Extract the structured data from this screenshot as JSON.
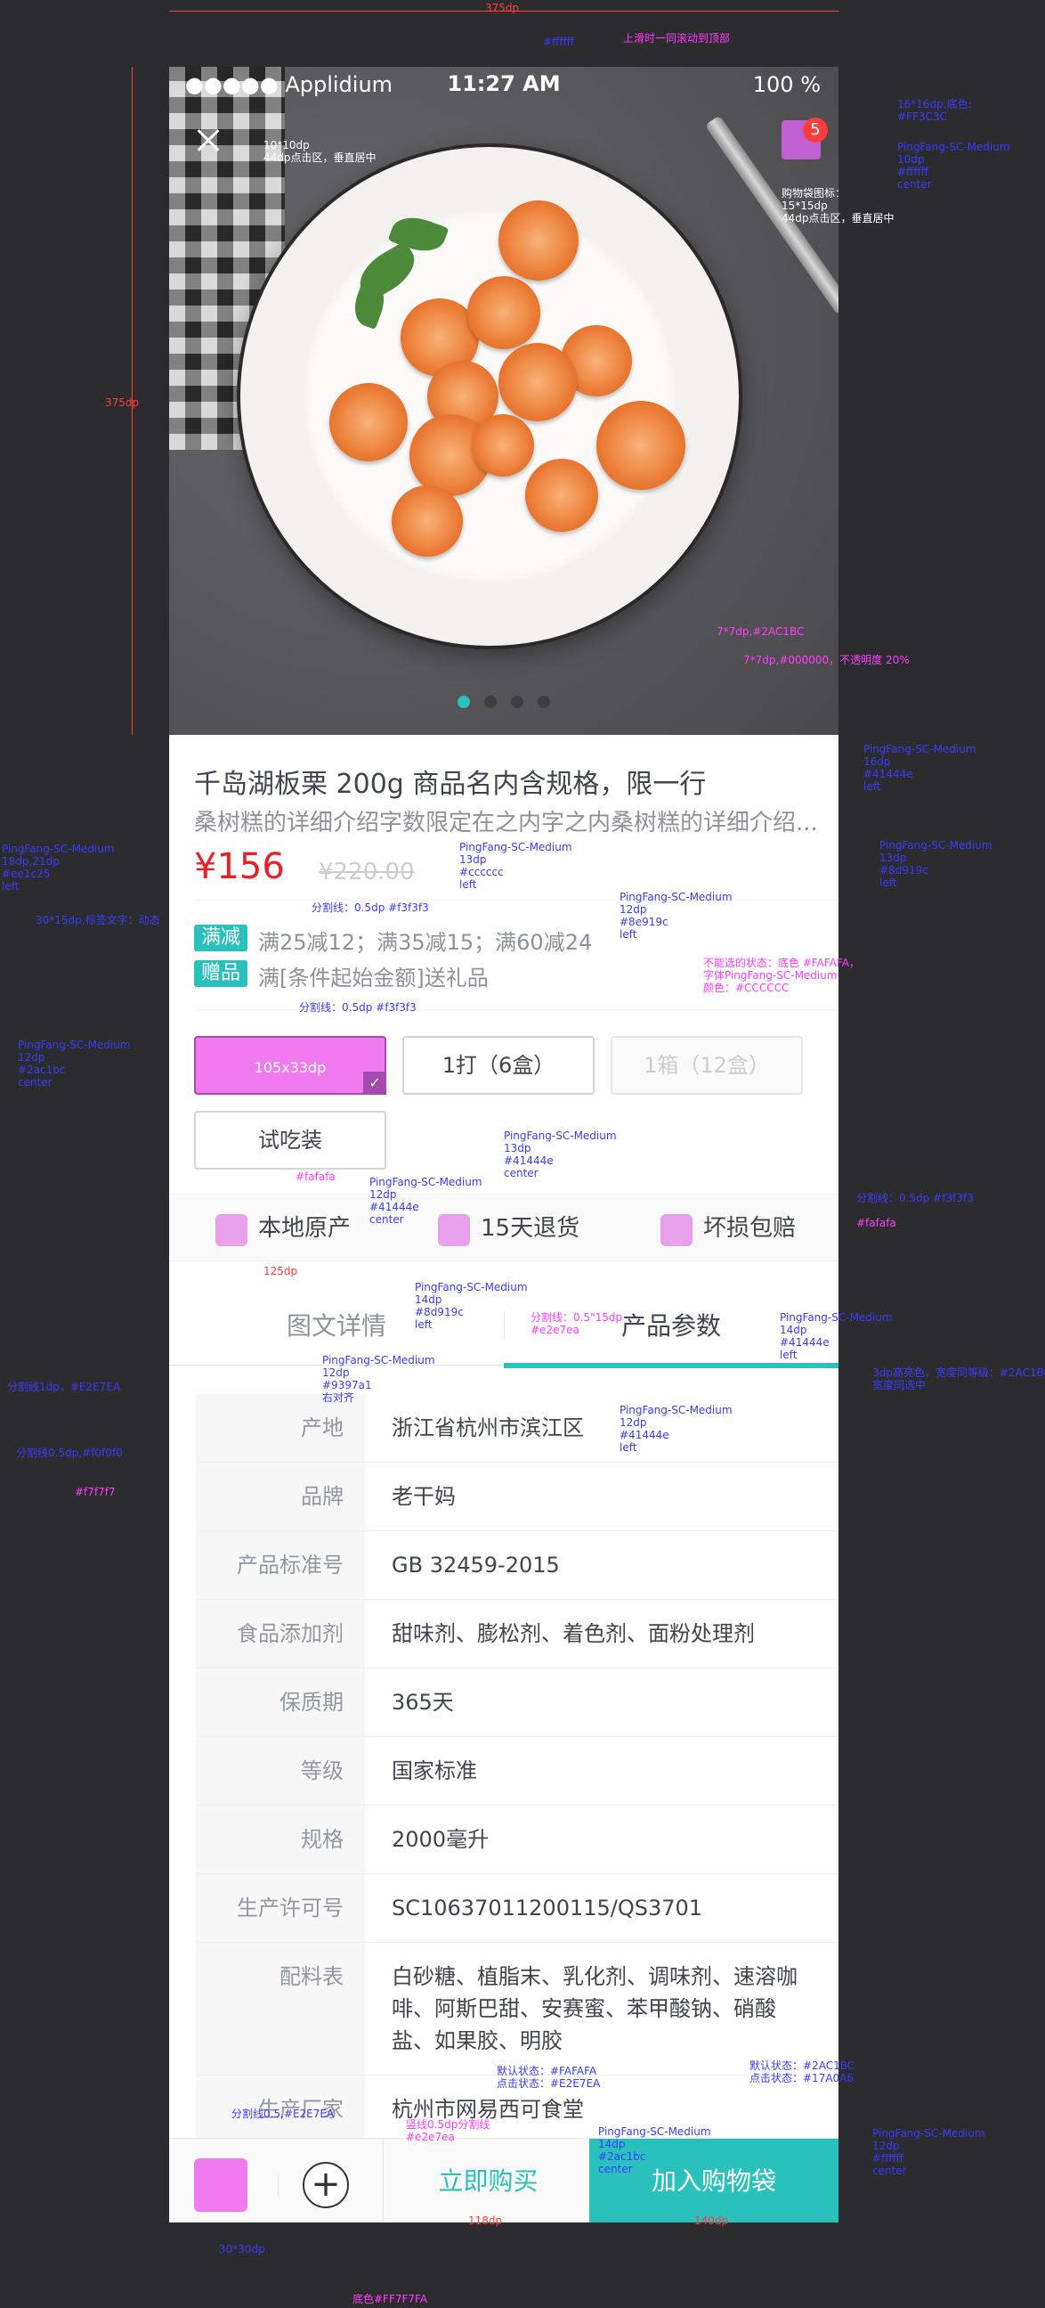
{
  "status_bar": {
    "carrier": "●●●●● Applidium",
    "time": "11:27 AM",
    "battery": "100 %"
  },
  "cart_badge": "5",
  "product": {
    "title": "千岛湖板栗 200g 商品名内含规格，限一行",
    "desc": "桑树糕的详细介绍字数限定在之内字之内桑树糕的详细介绍...",
    "price": "¥156",
    "old_price": "¥220.00"
  },
  "promos": [
    {
      "tag": "满减",
      "text": "满25减12；满35减15；满60减24"
    },
    {
      "tag": "赠品",
      "text": "满[条件起始金额]送礼品"
    }
  ],
  "options": [
    {
      "label": "105x33dp",
      "state": "selected"
    },
    {
      "label": "1打（6盒）",
      "state": "normal"
    },
    {
      "label": "1箱（12盒）",
      "state": "disabled"
    },
    {
      "label": "试吃装",
      "state": "normal"
    }
  ],
  "guarantees": [
    "本地原产",
    "15天退货",
    "坏损包赔"
  ],
  "tabs": [
    "图文详情",
    "产品参数"
  ],
  "params": [
    {
      "label": "产地",
      "value": "浙江省杭州市滨江区"
    },
    {
      "label": "品牌",
      "value": "老干妈"
    },
    {
      "label": "产品标准号",
      "value": "GB 32459-2015"
    },
    {
      "label": "食品添加剂",
      "value": "甜味剂、膨松剂、着色剂、面粉处理剂"
    },
    {
      "label": "保质期",
      "value": "365天"
    },
    {
      "label": "等级",
      "value": "国家标准"
    },
    {
      "label": "规格",
      "value": "2000毫升"
    },
    {
      "label": "生产许可号",
      "value": "SC10637011200115/QS3701"
    },
    {
      "label": "配料表",
      "value": "白砂糖、植脂末、乳化剂、调味剂、速溶咖啡、阿斯巴甜、安赛蜜、苯甲酸钠、硝酸盐、如果胶、明胶"
    },
    {
      "label": "生产厂家",
      "value": "杭州市网易西可食堂"
    }
  ],
  "bottom_bar": {
    "plus": "+",
    "buy_now": "立即购买",
    "add_cart": "加入购物袋"
  },
  "annotations": {
    "top_width": "375dp",
    "status_color": "#ffffff",
    "top_note": "上滑时一同滚动到顶部",
    "hero_height": "375dp",
    "close_note": "10*10dp\n44dp点击区，垂直居中",
    "badge_note": "16*16dp,底色:\n#FF3C3C",
    "badge_font": "PingFang-SC-Medium\n10dp\n#ffffff\ncenter",
    "cart_note": "购物袋图标：\n15*15dp\n44dp点击区，垂直居中",
    "dots_note1": "7*7dp,#2AC1BC",
    "dots_note2": "7*7dp,#000000，不透明度 20%",
    "title_font": "PingFang-SC-Medium\n16dp\n#41444e\nleft",
    "desc_font": "PingFang-SC-Medium\n13dp\n#8d919c\nleft",
    "price_font": "PingFang-SC-Medium\n18dp,21dp\n#ee1c25\nleft",
    "oldprice_font": "PingFang-SC-Medium\n13dp\n#cccccc\nleft",
    "divider_note": "分割线：0.5dp #f3f3f3",
    "tag_note": "30*15dp,标签文字：动态",
    "promo_font": "PingFang-SC-Medium\n12dp\n#8e919c\nleft",
    "disabled_note": "不能选的状态：底色 #FAFAFA，\n字体PingFang-SC-Medium\n颜色：#CCCCCC",
    "divider_note2": "分割线：0.5dp #f3f3f3",
    "option_font": "PingFang-SC-Medium\n12dp\n#2ac1bc\ncenter",
    "option_font2": "PingFang-SC-Medium\n13dp\n#41444e\ncenter",
    "guar_font": "PingFang-SC-Medium\n12dp\n#41444e\ncenter",
    "guar_bg": "#fafafa",
    "guar_div": "分割线：0.5dp #f3f3f3",
    "guar_bg2": "#fafafa",
    "guar_w": "125dp",
    "tab_font1": "PingFang-SC-Medium\n14dp\n#8d919c\nleft",
    "tab_sep": "分割线：0.5\"15dp\n#e2e7ea",
    "tab_font2": "PingFang-SC-Medium\n14dp\n#41444e\nleft",
    "tab_line": "3dp高亮色，宽度同等级：#2AC1BC\n宽度同选中",
    "tab_divider": "分割线1dp，#E2E7EA",
    "label_font": "PingFang-SC-Medium\n12dp\n#9397a1\n右对齐",
    "value_font": "PingFang-SC-Medium\n12dp\n#41444e\nleft",
    "row_divider": "分割线0.5dp,#f0f0f0",
    "label_bg": "#f7f7f7",
    "bottom_div": "分割线0.5,#E2E7EA",
    "plus_div": "竖线0.5dp分割线\n#e2e7ea",
    "buy_state": "默认状态：#FAFAFA\n点击状态：#E2E7EA",
    "buy_font": "PingFang-SC-Medium\n14dp\n#2ac1bc\ncenter",
    "cart_state": "默认状态：#2AC1BC\n点击状态：#17A0A6",
    "cart_font": "PingFang-SC-Medium\n12dp\n#ffffff\ncenter",
    "icon_size": "30*30dp",
    "plus_color": "底色#FF7F7FA",
    "buy_w": "118dp",
    "cart_w": "140dp"
  }
}
